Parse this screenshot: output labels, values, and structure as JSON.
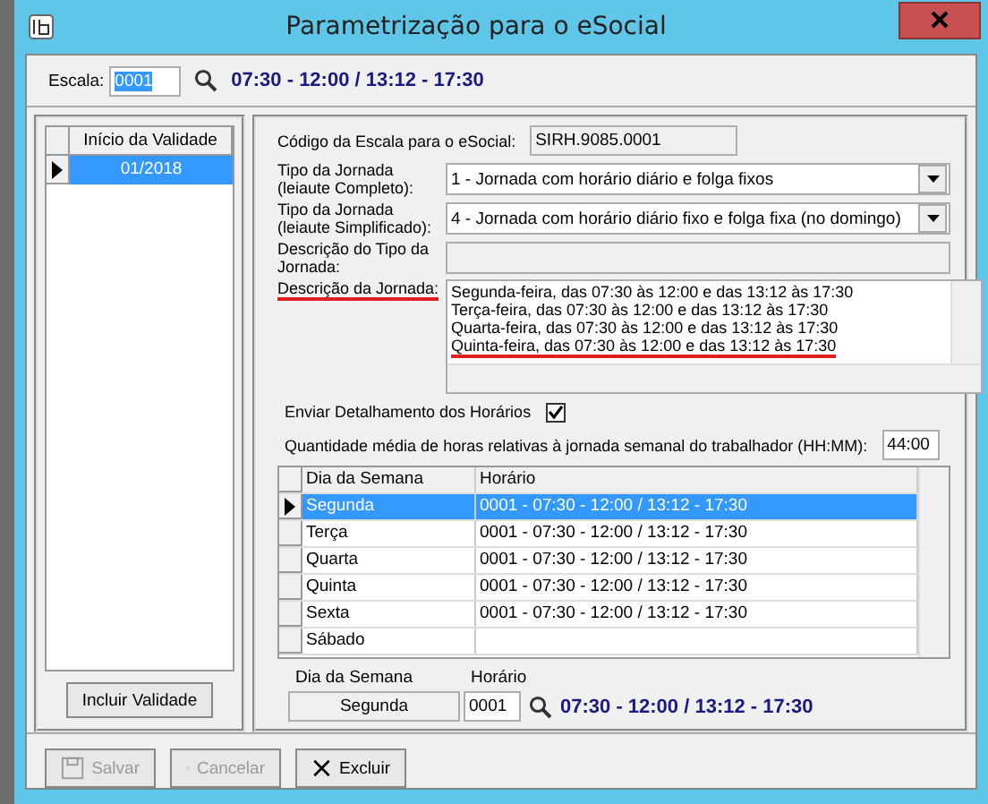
{
  "window": {
    "title": "Parametrização para o eSocial"
  },
  "escala": {
    "label": "Escala:",
    "value": "0001",
    "schedule": "07:30 - 12:00 / 13:12 - 17:30"
  },
  "validity": {
    "column": "Início da Validade",
    "rows": [
      {
        "value": "01/2018",
        "selected": true
      }
    ],
    "button": "Incluir Validade"
  },
  "form": {
    "code_label": "Código da Escala para o  eSocial:",
    "code_value": "SIRH.9085.0001",
    "fields": [
      {
        "kind": "dropdown",
        "label": "Tipo da Jornada (leiaute Completo):",
        "value": "1 - Jornada com horário diário e folga fixos",
        "underlined": false
      },
      {
        "kind": "dropdown",
        "label": "Tipo da Jornada (leiaute Simplificado):",
        "value": "4 - Jornada com horário diário fixo e folga fixa (no domingo)",
        "underlined": false
      },
      {
        "kind": "text",
        "label": "Descrição do Tipo da Jornada:",
        "underlined": false
      }
    ],
    "description": {
      "label": "Descrição da Jornada:",
      "underlined": true,
      "lines": [
        {
          "text": "Segunda-feira, das 07:30 às 12:00 e das 13:12 às 17:30",
          "underlined": false
        },
        {
          "text": "Terça-feira, das 07:30 às 12:00 e das 13:12 às 17:30",
          "underlined": false
        },
        {
          "text": "Quarta-feira, das 07:30 às 12:00 e das 13:12 às 17:30",
          "underlined": false
        },
        {
          "text": "Quinta-feira, das 07:30 às 12:00 e das 13:12 às 17:30",
          "underlined": true
        }
      ]
    },
    "send_details": {
      "label": "Enviar Detalhamento dos Horários",
      "checked": true
    },
    "weekly_hours": {
      "label": "Quantidade média de horas relativas à jornada semanal do trabalhador (HH:MM):",
      "value": "44:00"
    }
  },
  "table": {
    "columns": [
      "Dia da Semana",
      "Horário"
    ],
    "rows": [
      {
        "day": "Segunda",
        "schedule": "0001 - 07:30 - 12:00 / 13:12 - 17:30",
        "selected": true
      },
      {
        "day": "Terça",
        "schedule": "0001 - 07:30 - 12:00 / 13:12 - 17:30",
        "selected": false
      },
      {
        "day": "Quarta",
        "schedule": "0001 - 07:30 - 12:00 / 13:12 - 17:30",
        "selected": false
      },
      {
        "day": "Quinta",
        "schedule": "0001 - 07:30 - 12:00 / 13:12 - 17:30",
        "selected": false
      },
      {
        "day": "Sexta",
        "schedule": "0001 - 07:30 - 12:00 / 13:12 - 17:30",
        "selected": false
      },
      {
        "day": "Sábado",
        "selected": false
      }
    ]
  },
  "detail": {
    "day_label": "Dia da Semana",
    "day_value": "Segunda",
    "time_label": "Horário",
    "time_value": "0001",
    "schedule": "07:30 - 12:00 / 13:12 - 17:30"
  },
  "buttons": [
    {
      "kind": "save",
      "label": "Salvar",
      "disabled": true
    },
    {
      "kind": "cancel",
      "label": "Cancelar",
      "disabled": true
    },
    {
      "kind": "delete",
      "label": "Excluir",
      "disabled": false
    }
  ]
}
